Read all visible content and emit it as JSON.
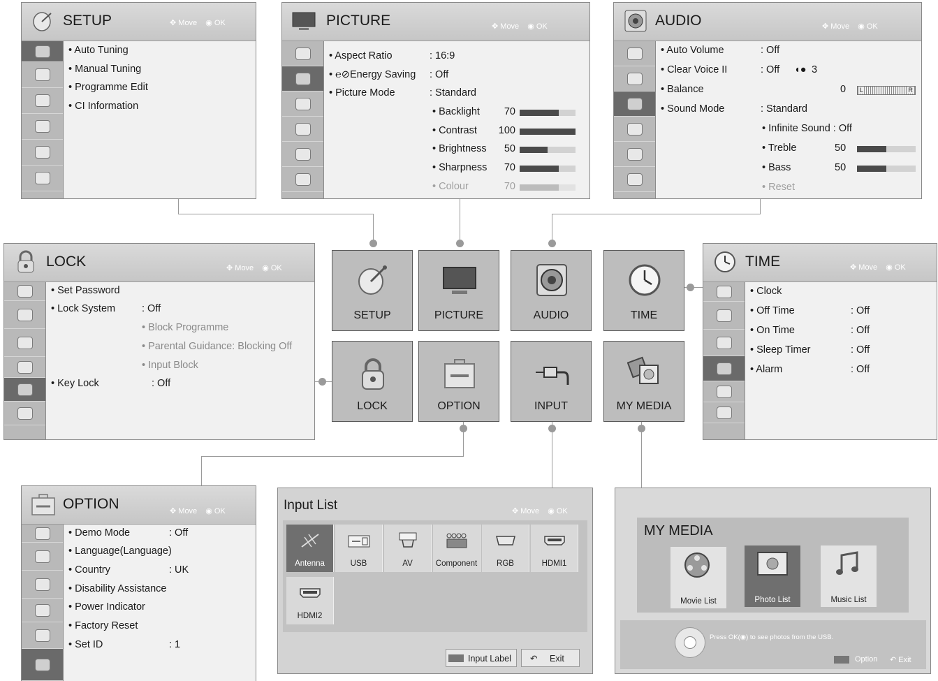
{
  "common": {
    "move": "Move",
    "ok": "OK"
  },
  "setup": {
    "title": "SETUP",
    "items": [
      "• Auto Tuning",
      "• Manual Tuning",
      "• Programme Edit",
      "• CI Information"
    ]
  },
  "picture": {
    "title": "PICTURE",
    "items": [
      {
        "label": "• Aspect Ratio",
        "value": ": 16:9"
      },
      {
        "label": "• ℮⊘Energy Saving",
        "value": ": Off"
      },
      {
        "label": "• Picture Mode",
        "value": ": Standard"
      }
    ],
    "sliders": [
      {
        "label": "• Backlight",
        "value": "70",
        "level": 0.7,
        "dim": false
      },
      {
        "label": "• Contrast",
        "value": "100",
        "level": 1.0,
        "dim": false
      },
      {
        "label": "• Brightness",
        "value": "50",
        "level": 0.5,
        "dim": false
      },
      {
        "label": "• Sharpness",
        "value": "70",
        "level": 0.7,
        "dim": false
      },
      {
        "label": "• Colour",
        "value": "70",
        "level": 0.7,
        "dim": true
      }
    ]
  },
  "audio": {
    "title": "AUDIO",
    "items": [
      {
        "label": "• Auto Volume",
        "value": ": Off"
      },
      {
        "label": "• Clear Voice II",
        "value": ": Off"
      },
      {
        "label": "• Balance",
        "value": "0"
      },
      {
        "label": "• Sound Mode",
        "value": ": Standard"
      }
    ],
    "clear_voice_level": "3",
    "balance_left": "L",
    "balance_right": "R",
    "infinite_sound": "• Infinite Sound : Off",
    "treble": {
      "label": "• Treble",
      "value": "50",
      "level": 0.5
    },
    "bass": {
      "label": "• Bass",
      "value": "50",
      "level": 0.5
    },
    "reset": "• Reset"
  },
  "lock": {
    "title": "LOCK",
    "set_password": "• Set Password",
    "lock_system": "• Lock System",
    "lock_system_value": ": Off",
    "sub": [
      "• Block Programme",
      "• Parental Guidance: Blocking Off",
      "• Input Block"
    ],
    "key_lock": "• Key Lock",
    "key_lock_value": ": Off"
  },
  "time": {
    "title": "TIME",
    "items": [
      {
        "label": "• Clock",
        "value": ""
      },
      {
        "label": "• Off Time",
        "value": ": Off"
      },
      {
        "label": "• On Time",
        "value": ": Off"
      },
      {
        "label": "• Sleep Timer",
        "value": ": Off"
      },
      {
        "label": "• Alarm",
        "value": ": Off"
      }
    ]
  },
  "option": {
    "title": "OPTION",
    "items": [
      {
        "label": "• Demo Mode",
        "value": ": Off"
      },
      {
        "label": "• Language(Language)",
        "value": ""
      },
      {
        "label": "• Country",
        "value": ": UK"
      },
      {
        "label": "• Disability Assistance",
        "value": ""
      },
      {
        "label": "• Power Indicator",
        "value": ""
      },
      {
        "label": "• Factory Reset",
        "value": ""
      },
      {
        "label": "• Set ID",
        "value": ": 1"
      }
    ]
  },
  "main_menu": {
    "tiles": [
      "SETUP",
      "PICTURE",
      "AUDIO",
      "TIME",
      "LOCK",
      "OPTION",
      "INPUT",
      "MY MEDIA"
    ]
  },
  "input_list": {
    "title": "Input List",
    "inputs": [
      "Antenna",
      "USB",
      "AV",
      "Component",
      "RGB",
      "HDMI1",
      "HDMI2"
    ],
    "input_label": "Input Label",
    "exit": "Exit"
  },
  "my_media": {
    "title": "MY MEDIA",
    "items": [
      "Movie List",
      "Photo List",
      "Music List"
    ],
    "hint": "Press OK(◉) to see photos from the USB.",
    "option": "Option",
    "exit": "Exit"
  }
}
